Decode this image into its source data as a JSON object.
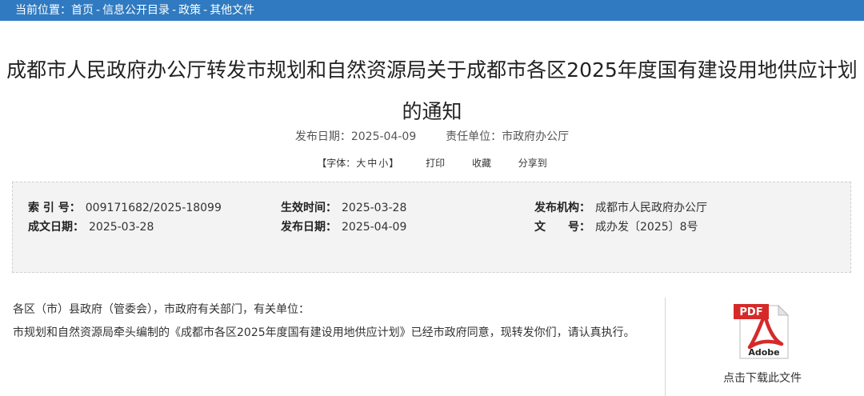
{
  "breadcrumb": {
    "prefix": "当前位置：",
    "items": [
      "首页",
      "信息公开目录",
      "政策",
      "其他文件"
    ],
    "separator": "-"
  },
  "article": {
    "title_line1": "成都市人民政府办公厅转发市规划和自然资源局关于成都市各区2025年度国有建设用地供应计划",
    "title_line2": "的通知",
    "publish_label": "发布日期：",
    "publish_date": "2025-04-09",
    "unit_label": "责任单位：",
    "unit": "市政府办公厅"
  },
  "toolbar": {
    "font_open": "【字体：",
    "font_large": "大",
    "font_medium": "中",
    "font_small": "小",
    "font_close": "】",
    "print": "打印",
    "favorite": "收藏",
    "share": "分享到"
  },
  "info": {
    "index_label": "索 引 号：",
    "index_value": "009171682/2025-18099",
    "effective_label": "生效时间：",
    "effective_value": "2025-03-28",
    "issuer_label": "发布机构：",
    "issuer_value": "成都市人民政府办公厅",
    "written_label": "成文日期：",
    "written_value": "2025-03-28",
    "publish_label": "发布日期：",
    "publish_value": "2025-04-09",
    "docno_label": "文　　号：",
    "docno_value": "成办发〔2025〕8号"
  },
  "body": {
    "paragraph1": "各区（市）县政府（管委会），市政府有关部门，有关单位：",
    "paragraph2": "市规划和自然资源局牵头编制的《成都市各区2025年度国有建设用地供应计划》已经市政府同意，现转发你们，请认真执行。"
  },
  "attachment": {
    "icon": "pdf-file-icon",
    "badge": "PDF",
    "brand": "Adobe",
    "label": "点击下载此文件"
  },
  "colors": {
    "header_bar": "#2f7ac0",
    "info_box_bg": "#f3f3f3",
    "pdf_red": "#d62a2a"
  }
}
